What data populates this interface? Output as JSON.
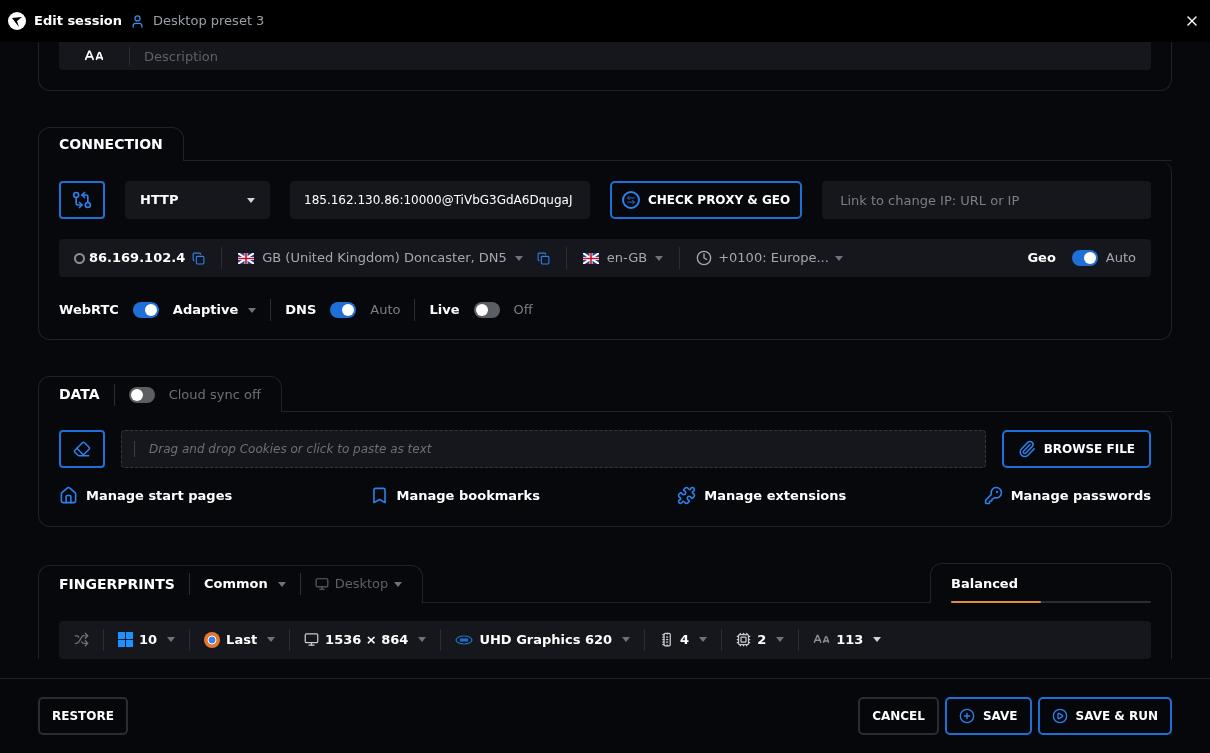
{
  "header": {
    "title": "Edit session",
    "preset": "Desktop preset 3"
  },
  "description": {
    "placeholder": "Description"
  },
  "connection": {
    "title": "CONNECTION",
    "proxy_type": "HTTP",
    "proxy": "185.162.130.86:10000@TiVbG3GdA6DqugaJ",
    "check_button": "CHECK PROXY & GEO",
    "change_ip": {
      "placeholder": "Link to change IP: URL or IP"
    },
    "ip": "86.169.102.4",
    "location": "GB (United Kingdom) Doncaster, DN5",
    "language": "en-GB",
    "timezone": "+0100: Europe...",
    "geo": {
      "label": "Geo",
      "on": true,
      "value": "Auto"
    },
    "options": [
      {
        "label": "WebRTC",
        "on": true,
        "value": "Adaptive",
        "dropdown": true
      },
      {
        "label": "DNS",
        "on": true,
        "value": "Auto",
        "dropdown": false
      },
      {
        "label": "Live",
        "on": false,
        "value": "Off",
        "dropdown": false
      }
    ]
  },
  "data": {
    "title": "DATA",
    "cloud_sync": {
      "on": false,
      "label": "Cloud sync off"
    },
    "drop": {
      "placeholder": "Drag and drop Cookies or click to paste as text"
    },
    "browse_button": "BROWSE FILE",
    "links": [
      {
        "kind": "home",
        "label": "Manage start pages"
      },
      {
        "kind": "bookmark",
        "label": "Manage bookmarks"
      },
      {
        "kind": "extension",
        "label": "Manage extensions"
      },
      {
        "kind": "password",
        "label": "Manage passwords"
      }
    ]
  },
  "fingerprints": {
    "title": "FINGERPRINTS",
    "mode": "Common",
    "device": {
      "label": "Desktop",
      "disabled": true
    },
    "profile": {
      "label": "Balanced",
      "level": 0.45
    },
    "items": [
      {
        "kind": "shuffle"
      },
      {
        "kind": "os",
        "value": "10"
      },
      {
        "kind": "browser",
        "value": "Last"
      },
      {
        "kind": "screen",
        "value": "1536 × 864"
      },
      {
        "kind": "gpu",
        "value": "UHD Graphics 620"
      },
      {
        "kind": "cpu",
        "value": "4"
      },
      {
        "kind": "memory",
        "value": "2"
      },
      {
        "kind": "fonts",
        "value": "113"
      }
    ]
  },
  "footer": {
    "restore": "RESTORE",
    "cancel": "CANCEL",
    "save": "SAVE",
    "save_run": "SAVE & RUN"
  }
}
